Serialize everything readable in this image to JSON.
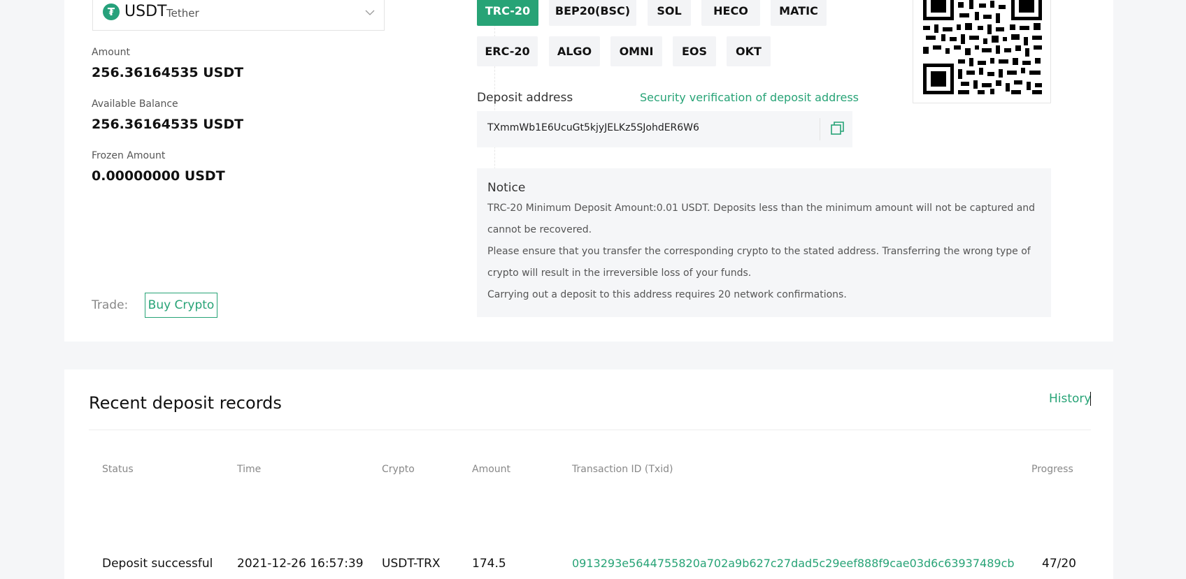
{
  "coin": {
    "logo_glyph": "₮",
    "symbol": "USDT",
    "name": "Tether",
    "icon": "chevron-down-icon"
  },
  "balances": [
    {
      "label": "Amount",
      "value": "256.36164535 USDT"
    },
    {
      "label": "Available Balance",
      "value": "256.36164535 USDT"
    },
    {
      "label": "Frozen Amount",
      "value": "0.00000000 USDT"
    }
  ],
  "trade": {
    "label": "Trade:",
    "buy_label": "Buy Crypto"
  },
  "networks": {
    "row1": [
      "TRC-20",
      "BEP20(BSC)",
      "SOL",
      "HECO",
      "MATIC"
    ],
    "row2": [
      "ERC-20",
      "ALGO",
      "OMNI",
      "EOS",
      "OKT"
    ],
    "selected": "TRC-20"
  },
  "deposit": {
    "label": "Deposit address",
    "security_link": "Security verification of deposit address",
    "address": "TXmmWb1E6UcuGt5kjyJELKz5SJohdER6W6",
    "copy_icon": "copy-icon"
  },
  "notice": {
    "title": "Notice",
    "lines": [
      "TRC-20 Minimum Deposit Amount:0.01 USDT. Deposits less than the minimum amount will not be captured and cannot be recovered.",
      "Please ensure that you transfer the corresponding crypto to the stated address. Transferring the wrong type of crypto will result in the irreversible loss of your funds.",
      "Carrying out a deposit to this address requires 20 network confirmations."
    ]
  },
  "records": {
    "title": "Recent deposit records",
    "history_label": "History",
    "columns": [
      "Status",
      "Time",
      "Crypto",
      "Amount",
      "Transaction ID (Txid)",
      "Progress"
    ],
    "rows": [
      {
        "status": "Deposit successful",
        "time": "2021-12-26 16:57:39",
        "crypto": "USDT-TRX",
        "amount": "174.5",
        "txid": "0913293e5644755820a702a9b627c27dad5c29eef888f9cae03d6c63937489cb",
        "progress": "47/20"
      }
    ]
  },
  "colors": {
    "accent": "#27a376",
    "background": "#f5f6f8",
    "panel": "#ffffff"
  }
}
